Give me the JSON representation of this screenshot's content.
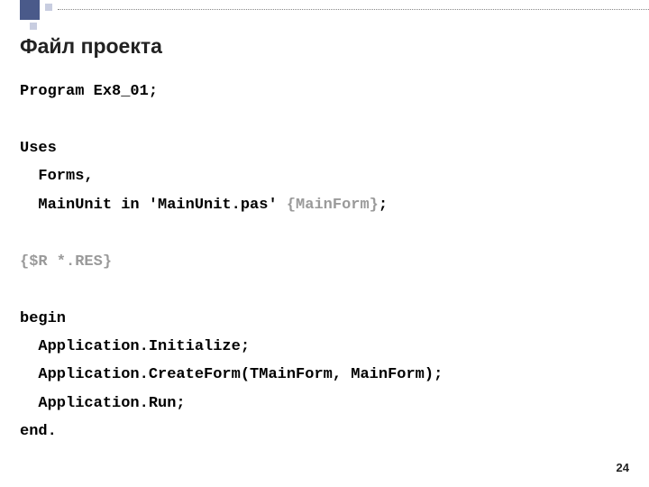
{
  "title": "Файл проекта",
  "code": {
    "l1": "Program Ex8_01;",
    "l2": "",
    "l3": "Uses",
    "l4": "  Forms,",
    "l5a": "  MainUnit in 'MainUnit.pas' ",
    "l5b": "{MainForm}",
    "l5c": ";",
    "l6": "",
    "l7": "{$R *.RES}",
    "l8": "",
    "l9": "begin",
    "l10": "  Application.Initialize;",
    "l11": "  Application.CreateForm(TMainForm, MainForm);",
    "l12": "  Application.Run;",
    "l13": "end."
  },
  "page_number": "24"
}
